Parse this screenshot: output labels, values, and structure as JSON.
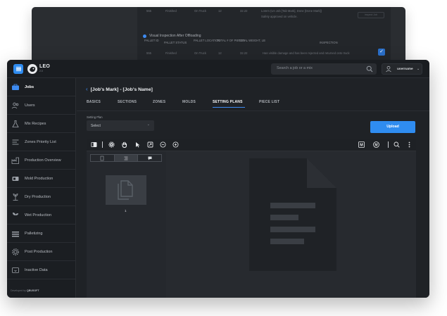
{
  "back_window": {
    "row1": {
      "id": "555",
      "status": "Finished",
      "location": "On Truck",
      "pieces": "12",
      "weight": "32.22"
    },
    "row1_inspection_line1": "Lorem (Un Job [Tab Mark], Done [Done Mark])",
    "row1_inspection_line2": "Safety approved on vehicle.",
    "row1_action": "Inspect Job",
    "section_title": "Visual Inspection After Offloading",
    "headers": [
      "PALLET ID",
      "PALLET STATUS",
      "PALLET LOCATION",
      "TOTAL # OF PIECES",
      "TOTAL WEIGHT, LB",
      "INSPECTION"
    ],
    "row2": {
      "id": "555",
      "status": "Finished",
      "location": "On Truck",
      "pieces": "12",
      "weight": "32.22",
      "inspection": "Has visible damage and has been rejected and returned onto truck"
    }
  },
  "app": {
    "logo_text": "LEO",
    "logo_sub": "2.0"
  },
  "topbar": {
    "search_placeholder": "Search a job or a mix",
    "username": "username"
  },
  "sidebar": {
    "items": [
      {
        "label": "Jobs",
        "icon": "briefcase-icon"
      },
      {
        "label": "Users",
        "icon": "users-icon"
      },
      {
        "label": "Mix Recipes",
        "icon": "flask-icon"
      },
      {
        "label": "Zones Priority List",
        "icon": "list-icon"
      },
      {
        "label": "Production Overview",
        "icon": "factory-icon"
      },
      {
        "label": "Mold Production",
        "icon": "mold-icon"
      },
      {
        "label": "Dry Production",
        "icon": "plant-icon"
      },
      {
        "label": "Wet Production",
        "icon": "sprout-icon"
      },
      {
        "label": "Palletizing",
        "icon": "pallet-icon"
      },
      {
        "label": "Post Production",
        "icon": "gear-icon"
      },
      {
        "label": "Inactive Data",
        "icon": "archive-icon"
      }
    ],
    "footer_prefix": "Developed by",
    "footer_brand": "QBUSOFT"
  },
  "page": {
    "title": "[Job's Mark] - [Job's Name]",
    "tabs": [
      "BASICS",
      "SECTIONS",
      "ZONES",
      "MOLDS",
      "SETTING PLANS",
      "PIECE LIST"
    ],
    "active_tab": "SETTING PLANS",
    "setting_plan_label": "Setting Plan",
    "setting_plan_value": "Select",
    "upload_label": "Upload",
    "page_number": "1"
  },
  "colors": {
    "accent": "#2f8cf0",
    "window_bg": "#1f2226",
    "sidebar_bg": "#1b1e22"
  }
}
